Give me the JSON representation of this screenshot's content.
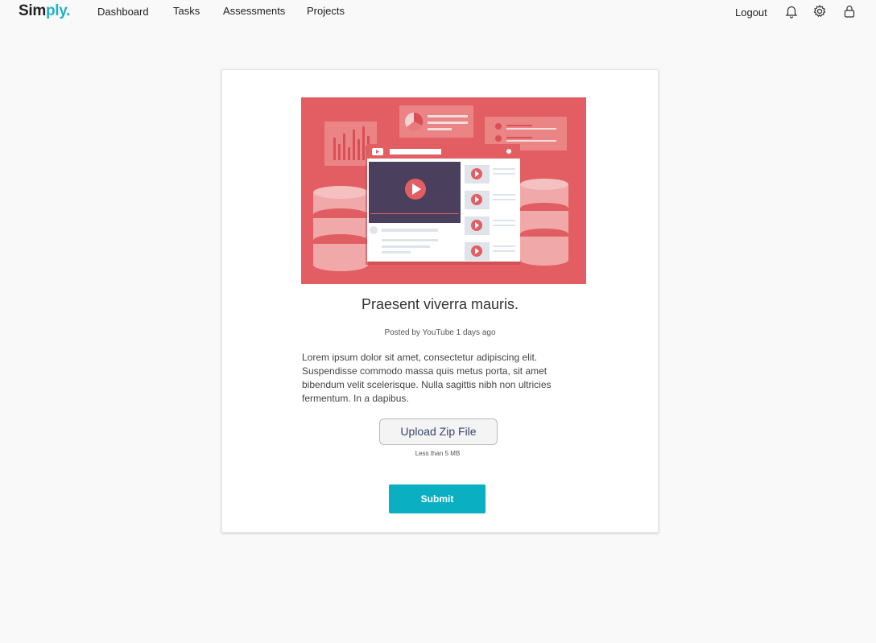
{
  "brand": {
    "part1": "Sim",
    "part2": "ply."
  },
  "nav": [
    {
      "label": "Dashboard"
    },
    {
      "label": "Tasks"
    },
    {
      "label": "Assessments"
    },
    {
      "label": "Projects"
    }
  ],
  "header": {
    "logout_label": "Logout",
    "icons": [
      "bell-icon",
      "gear-icon",
      "user-icon"
    ]
  },
  "card": {
    "title": "Praesent viverra mauris.",
    "byline": "Posted by YouTube 1 days ago",
    "description": "Lorem ipsum dolor sit amet, consectetur adipiscing elit. Suspendisse commodo massa quis metus porta, sit amet bibendum velit scelerisque. Nulla sagittis nibh non ultricies fermentum. In a dapibus.",
    "upload_label": "Upload Zip File",
    "upload_hint": "Less than 5 MB",
    "submit_label": "Submit"
  },
  "colors": {
    "accent": "#0ab0c2",
    "brand_accent": "#1fb2c6",
    "hero_background": "#e25e62"
  }
}
